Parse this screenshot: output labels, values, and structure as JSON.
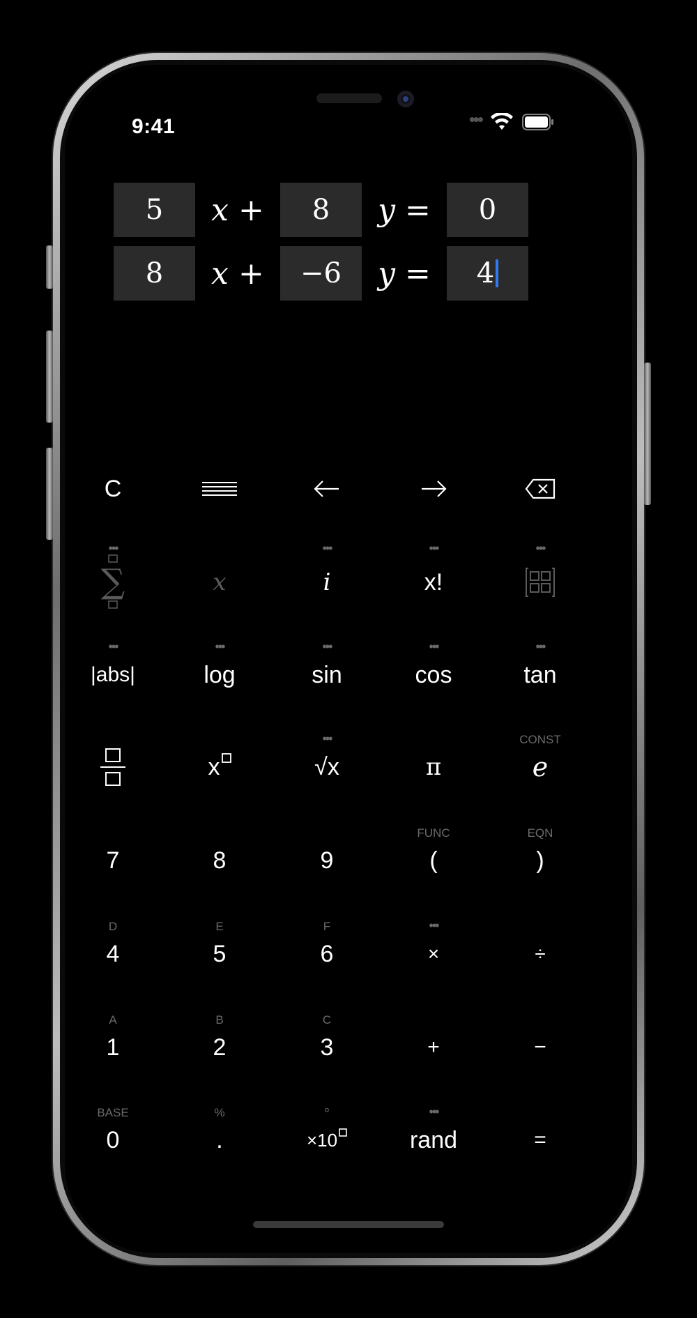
{
  "status_bar": {
    "time": "9:41"
  },
  "equations": [
    {
      "a": "5",
      "op1": "x +",
      "b": "8",
      "op2": "y =",
      "c": "0"
    },
    {
      "a": "8",
      "op1": "x +",
      "b": "−6",
      "op2": "y =",
      "c": "4"
    }
  ],
  "keypad": {
    "row1": [
      "C",
      "",
      "",
      "",
      ""
    ],
    "row2": {
      "sum": "∑",
      "x": "x",
      "i": "i",
      "factorial": "x!",
      "matrix": ""
    },
    "row3": [
      "|abs|",
      "log",
      "sin",
      "cos",
      "tan"
    ],
    "row4": {
      "fraction": "",
      "power": "x",
      "sqrt": "√x",
      "pi": "π",
      "e": "e",
      "e_sub": "CONST"
    },
    "row5": {
      "labels": [
        "7",
        "8",
        "9",
        "(",
        ")"
      ],
      "subs": [
        "",
        "",
        "",
        "FUNC",
        "EQN"
      ]
    },
    "row6": {
      "labels": [
        "4",
        "5",
        "6",
        "×",
        "÷"
      ],
      "subs": [
        "D",
        "E",
        "F",
        "",
        ""
      ]
    },
    "row7": {
      "labels": [
        "1",
        "2",
        "3",
        "+",
        "−"
      ],
      "subs": [
        "A",
        "B",
        "C",
        "",
        ""
      ]
    },
    "row8": {
      "labels": [
        "0",
        ".",
        "×10",
        "rand",
        "="
      ],
      "subs": [
        "BASE",
        "%",
        "°",
        "",
        ""
      ]
    },
    "more_dots": "•••"
  },
  "colors": {
    "background": "#000000",
    "input_box": "#2b2b2b",
    "caret": "#2f7bf5",
    "secondary_text": "#6a6a6a"
  }
}
